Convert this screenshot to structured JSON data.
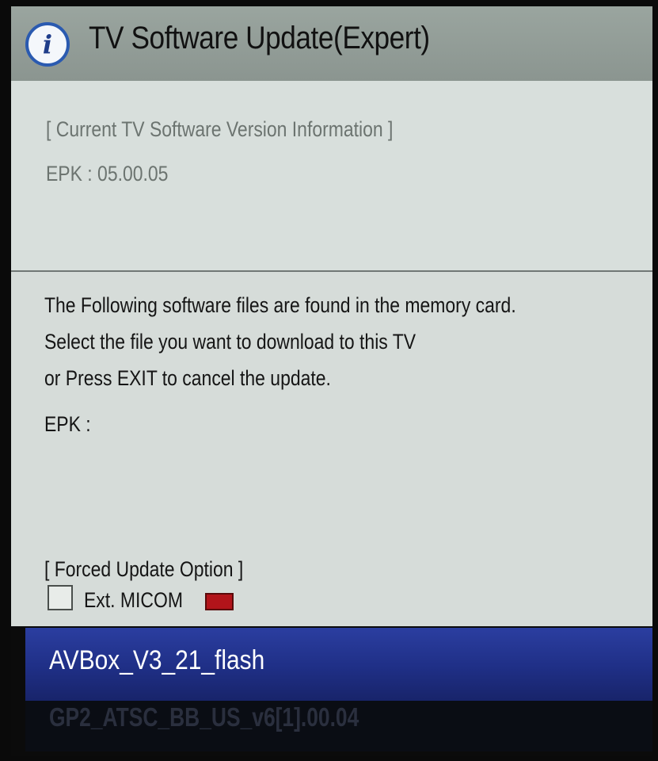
{
  "dialog": {
    "title": "TV Software Update(Expert)",
    "info_icon_glyph": "i"
  },
  "current_info": {
    "heading": "[ Current TV Software Version Information ]",
    "epk": "EPK : 05.00.05"
  },
  "found_files": {
    "line1": "The Following software files are found in the memory card.",
    "line2": "Select the file you want to download to this TV",
    "line3": "or Press EXIT to cancel the update.",
    "epk_label": "EPK :"
  },
  "forced_update": {
    "heading": "[ Forced Update Option ]",
    "ext_micom_label": "Ext. MICOM",
    "checked": false
  },
  "file_list": {
    "selected_index": 0,
    "items": [
      "AVBox_V3_21_flash",
      "GP2_ATSC_BB_US_v6[1].00.04"
    ]
  },
  "colors": {
    "header_bg": "#939d98",
    "panel_bg": "#d6dcd9",
    "selected_bg": "#1f2f86",
    "info_icon_ring": "#2a5ab0",
    "micom_chip": "#b2141a"
  },
  "icons": {
    "info": "info-icon",
    "checkbox": "checkbox-icon",
    "micom_status": "red-indicator-icon"
  }
}
